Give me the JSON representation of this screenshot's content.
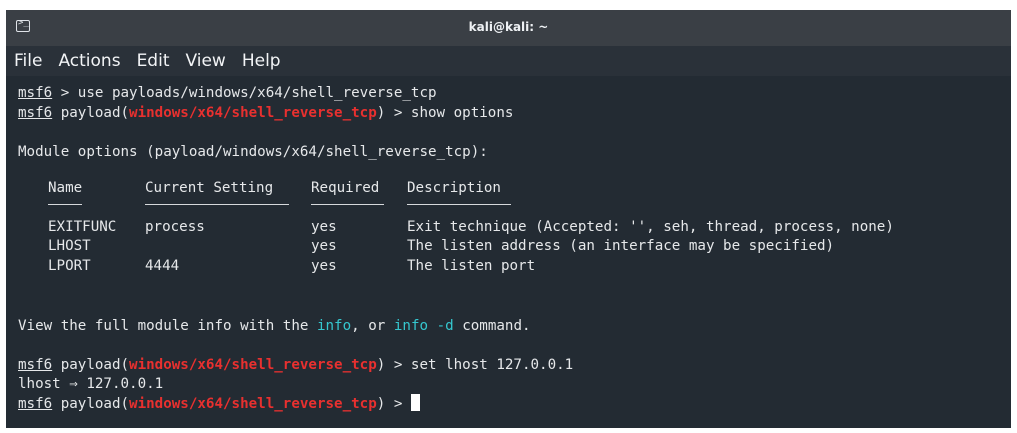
{
  "window": {
    "title": "kali@kali: ~",
    "icon": "terminal-icon"
  },
  "menu": [
    "File",
    "Actions",
    "Edit",
    "View",
    "Help"
  ],
  "terminal": {
    "prompt": "msf6",
    "line1_cmd": " > use payloads/windows/x64/shell_reverse_tcp",
    "payload_prefix": " payload(",
    "payload_name": "windows/x64/shell_reverse_tcp",
    "payload_suffix_show": ") > show options",
    "module_options": "Module options (payload/windows/x64/shell_reverse_tcp):",
    "headers": [
      "Name",
      "Current Setting",
      "Required",
      "Description"
    ],
    "rows": [
      {
        "name": "EXITFUNC",
        "setting": "process",
        "required": "yes",
        "description": "Exit technique (Accepted: '', seh, thread, process, none)"
      },
      {
        "name": "LHOST",
        "setting": "",
        "required": "yes",
        "description": "The listen address (an interface may be specified)"
      },
      {
        "name": "LPORT",
        "setting": "4444",
        "required": "yes",
        "description": "The listen port"
      }
    ],
    "info_pre": "View the full module info with the ",
    "info_cmd": "info",
    "info_mid": ", or ",
    "info_cmd2": "info -d",
    "info_post": " command.",
    "payload_suffix_set": ") > set lhost 127.0.0.1",
    "lhost_result": "lhost ⇒ 127.0.0.1",
    "payload_suffix_final": ") > "
  },
  "colors": {
    "background": "#232b33",
    "payload_red": "#e8302f",
    "info_cyan": "#35c7cf"
  }
}
